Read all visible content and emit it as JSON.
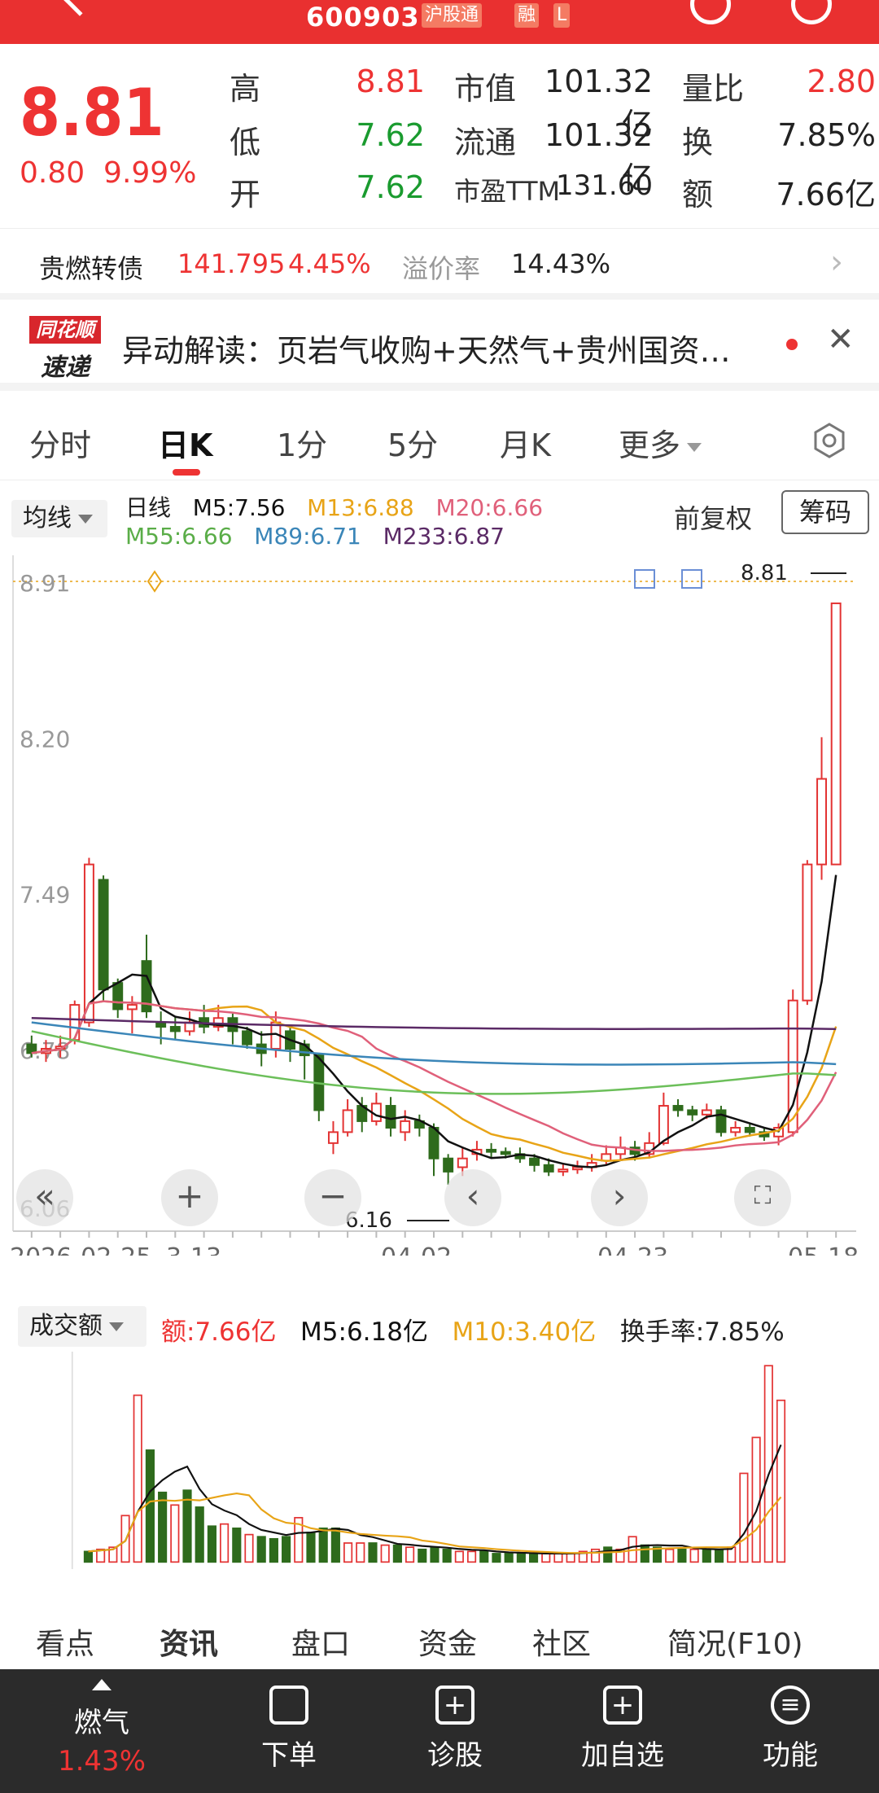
{
  "header": {
    "stock_code": "600903",
    "badge_hgt": "沪股通",
    "badge_rong": "融",
    "badge_l": "L"
  },
  "quote": {
    "price": "8.81",
    "change": "0.80",
    "change_pct": "9.99%",
    "high_label": "高",
    "high": "8.81",
    "low_label": "低",
    "low": "7.62",
    "open_label": "开",
    "open": "7.62",
    "mktcap_label": "市值",
    "mktcap": "101.32亿",
    "float_label": "流通",
    "float": "101.32亿",
    "pe_label": "市盈TTM",
    "pe": "131.60",
    "vol_ratio_label": "量比",
    "vol_ratio": "2.80",
    "turnover_label": "换",
    "turnover": "7.85%",
    "amount_label": "额",
    "amount": "7.66亿"
  },
  "convertible": {
    "name": "贵燃转债",
    "price": "141.795",
    "pct": "4.45%",
    "premium_label": "溢价率",
    "premium": "14.43%"
  },
  "news": {
    "logo_top": "同花顺",
    "logo_bottom": "速递",
    "text": "异动解读：页岩气收购+天然气+贵州国资…"
  },
  "tabs": [
    "分时",
    "日K",
    "1分",
    "5分",
    "月K",
    "更多"
  ],
  "ma": {
    "selector": "均线",
    "period": "日线",
    "m5": "M5:7.56",
    "m13": "M13:6.88",
    "m20": "M20:6.66",
    "m55": "M55:6.66",
    "m89": "M89:6.71",
    "m233": "M233:6.87",
    "fq": "前复权",
    "chips": "筹码"
  },
  "colors": {
    "up": "#e33333",
    "down": "#2e6b1c",
    "m5": "#111111",
    "m13": "#e8a417",
    "m20": "#e0607a",
    "m55": "#6cbf5a",
    "m89": "#3b86b8",
    "m233": "#5b2a66"
  },
  "chart_data": {
    "type": "candlestick",
    "y_ticks": [
      "8.91",
      "8.20",
      "7.49",
      "6.78",
      "6.06"
    ],
    "x_ticks": [
      "2026-02-25",
      "3-13",
      "04-02",
      "04-23",
      "05-18"
    ],
    "high_label": "8.81",
    "low_label": "6.16",
    "ylim": [
      6.06,
      8.91
    ],
    "candles": [
      [
        6.8,
        6.76,
        6.84,
        6.74
      ],
      [
        6.76,
        6.78,
        6.82,
        6.72
      ],
      [
        6.78,
        6.79,
        6.84,
        6.74
      ],
      [
        6.82,
        6.98,
        7.0,
        6.8
      ],
      [
        6.9,
        7.62,
        7.65,
        6.88
      ],
      [
        7.55,
        7.05,
        7.57,
        7.0
      ],
      [
        7.08,
        6.96,
        7.1,
        6.92
      ],
      [
        6.96,
        6.98,
        7.02,
        6.85
      ],
      [
        7.18,
        6.95,
        7.3,
        6.92
      ],
      [
        6.9,
        6.88,
        6.95,
        6.8
      ],
      [
        6.88,
        6.86,
        6.93,
        6.82
      ],
      [
        6.86,
        6.9,
        6.95,
        6.84
      ],
      [
        6.92,
        6.88,
        6.98,
        6.85
      ],
      [
        6.88,
        6.92,
        6.98,
        6.86
      ],
      [
        6.92,
        6.86,
        6.94,
        6.8
      ],
      [
        6.86,
        6.8,
        6.88,
        6.78
      ],
      [
        6.8,
        6.76,
        6.86,
        6.7
      ],
      [
        6.78,
        6.9,
        6.95,
        6.74
      ],
      [
        6.86,
        6.78,
        6.88,
        6.72
      ],
      [
        6.8,
        6.75,
        6.82,
        6.64
      ],
      [
        6.75,
        6.5,
        6.76,
        6.45
      ],
      [
        6.35,
        6.4,
        6.45,
        6.3
      ],
      [
        6.4,
        6.5,
        6.55,
        6.38
      ],
      [
        6.52,
        6.45,
        6.56,
        6.4
      ],
      [
        6.45,
        6.53,
        6.58,
        6.43
      ],
      [
        6.52,
        6.42,
        6.56,
        6.38
      ],
      [
        6.4,
        6.45,
        6.5,
        6.36
      ],
      [
        6.45,
        6.42,
        6.48,
        6.38
      ],
      [
        6.42,
        6.28,
        6.44,
        6.2
      ],
      [
        6.28,
        6.22,
        6.3,
        6.16
      ],
      [
        6.24,
        6.28,
        6.33,
        6.2
      ],
      [
        6.3,
        6.32,
        6.36,
        6.27
      ],
      [
        6.32,
        6.31,
        6.35,
        6.28
      ],
      [
        6.31,
        6.3,
        6.33,
        6.28
      ],
      [
        6.3,
        6.28,
        6.33,
        6.26
      ],
      [
        6.28,
        6.25,
        6.3,
        6.22
      ],
      [
        6.25,
        6.22,
        6.28,
        6.2
      ],
      [
        6.22,
        6.23,
        6.26,
        6.2
      ],
      [
        6.23,
        6.24,
        6.27,
        6.21
      ],
      [
        6.24,
        6.26,
        6.3,
        6.22
      ],
      [
        6.27,
        6.3,
        6.34,
        6.25
      ],
      [
        6.3,
        6.33,
        6.38,
        6.27
      ],
      [
        6.33,
        6.3,
        6.36,
        6.27
      ],
      [
        6.3,
        6.35,
        6.4,
        6.28
      ],
      [
        6.35,
        6.52,
        6.58,
        6.34
      ],
      [
        6.52,
        6.5,
        6.55,
        6.47
      ],
      [
        6.5,
        6.48,
        6.52,
        6.45
      ],
      [
        6.48,
        6.5,
        6.53,
        6.46
      ],
      [
        6.5,
        6.4,
        6.52,
        6.38
      ],
      [
        6.4,
        6.42,
        6.45,
        6.38
      ],
      [
        6.42,
        6.4,
        6.44,
        6.38
      ],
      [
        6.4,
        6.38,
        6.42,
        6.36
      ],
      [
        6.38,
        6.42,
        6.44,
        6.34
      ],
      [
        6.4,
        7.0,
        7.05,
        6.38
      ],
      [
        7.0,
        7.62,
        7.64,
        6.98
      ],
      [
        7.62,
        8.01,
        8.2,
        7.55
      ],
      [
        7.62,
        8.81,
        8.81,
        7.62
      ]
    ],
    "volume": {
      "selector": "成交额",
      "amount": "额:7.66亿",
      "m5": "M5:6.18亿",
      "m10": "M10:3.40亿",
      "turnover": "换手率:7.85%",
      "bars": [
        0.5,
        0.6,
        0.7,
        2.2,
        7.9,
        5.3,
        3.3,
        2.7,
        3.4,
        2.6,
        1.7,
        1.8,
        1.6,
        1.3,
        1.2,
        1.1,
        1.2,
        2.1,
        1.4,
        1.6,
        1.6,
        0.9,
        0.9,
        0.9,
        0.8,
        0.8,
        0.7,
        0.6,
        0.7,
        0.6,
        0.5,
        0.5,
        0.5,
        0.4,
        0.4,
        0.4,
        0.4,
        0.4,
        0.4,
        0.4,
        0.5,
        0.6,
        0.7,
        0.6,
        1.2,
        0.8,
        0.7,
        0.6,
        0.6,
        0.6,
        0.6,
        0.6,
        0.7,
        4.2,
        5.9,
        9.3,
        7.66
      ]
    }
  },
  "bottom_tabs_peek": [
    "看点",
    "资讯",
    "盘口",
    "资金",
    "社区",
    "简况(F10)"
  ],
  "bottom_nav": {
    "sector": "燃气",
    "sector_pct": "1.43%",
    "order": "下单",
    "diagnose": "诊股",
    "add_fav": "加自选",
    "func": "功能"
  }
}
